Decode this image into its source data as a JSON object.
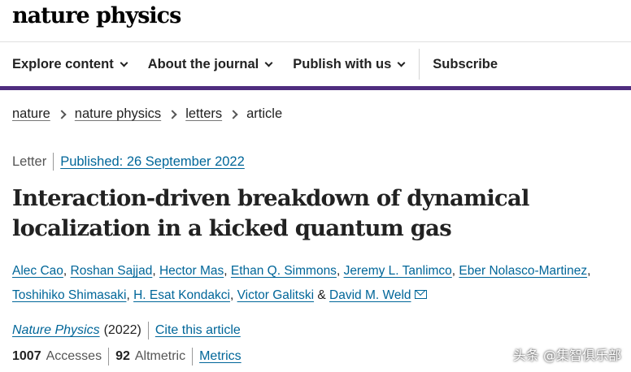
{
  "header": {
    "logo": "nature physics"
  },
  "nav": {
    "items": [
      {
        "label": "Explore content"
      },
      {
        "label": "About the journal"
      },
      {
        "label": "Publish with us"
      }
    ],
    "subscribe": "Subscribe"
  },
  "breadcrumb": [
    "nature",
    "nature physics",
    "letters",
    "article"
  ],
  "article": {
    "type": "Letter",
    "published": "Published: 26 September 2022",
    "title": "Interaction-driven breakdown of dynamical localization in a kicked quantum gas",
    "authors": [
      "Alec Cao",
      "Roshan Sajjad",
      "Hector Mas",
      "Ethan Q. Simmons",
      "Jeremy L. Tanlimco",
      "Eber Nolasco-Martinez",
      "Toshihiko Shimasaki",
      "H. Esat Kondakci",
      "Victor Galitski",
      "David M. Weld"
    ],
    "author_sep": ", ",
    "author_last_sep": " & ",
    "journal": "Nature Physics",
    "year": "(2022)",
    "cite": "Cite this article",
    "accesses_count": "1007",
    "accesses_label": "Accesses",
    "altmetric_count": "92",
    "altmetric_label": "Altmetric",
    "metrics": "Metrics"
  },
  "colors": {
    "brand_purple": "#4f2d7f",
    "link": "#006699"
  },
  "icons": [
    "chevron-down-icon",
    "chevron-right-icon",
    "mail-icon"
  ],
  "watermark": "头条 @集智俱乐部"
}
